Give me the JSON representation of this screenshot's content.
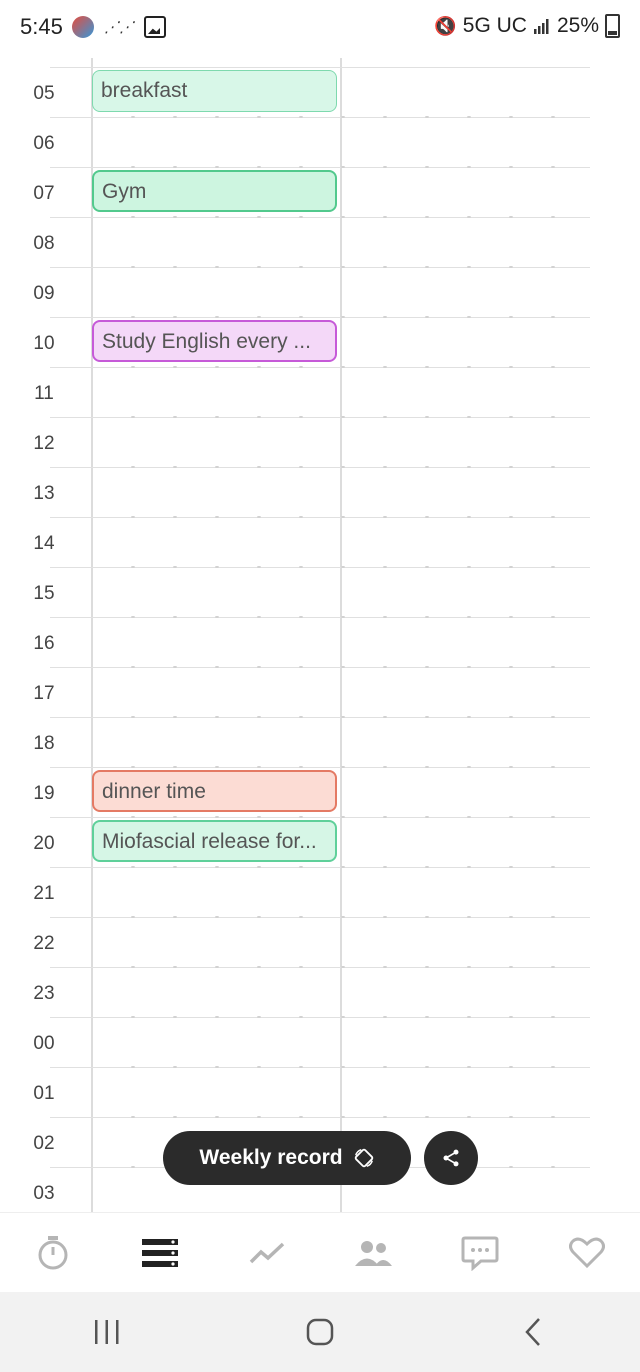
{
  "status_bar": {
    "time": "5:45",
    "network": "5G UC",
    "battery": "25%"
  },
  "hours": [
    "05",
    "06",
    "07",
    "08",
    "09",
    "10",
    "11",
    "12",
    "13",
    "14",
    "15",
    "16",
    "17",
    "18",
    "19",
    "20",
    "21",
    "22",
    "23",
    "00",
    "01",
    "02",
    "03"
  ],
  "events": [
    {
      "title": "breakfast",
      "hour": "05",
      "style": "mint"
    },
    {
      "title": "Gym",
      "hour": "07",
      "style": "green"
    },
    {
      "title": "Study English every ...",
      "hour": "10",
      "style": "purple"
    },
    {
      "title": "dinner time",
      "hour": "19",
      "style": "salmon"
    },
    {
      "title": "Miofascial release for...",
      "hour": "20",
      "style": "mint2"
    }
  ],
  "floating": {
    "weekly_label": "Weekly record"
  },
  "nav": [
    "timer-icon",
    "list-icon",
    "chart-icon",
    "people-icon",
    "chat-icon",
    "heart-icon"
  ],
  "colors": {
    "pill": "#2b2b2b",
    "active_nav": "#222222",
    "inactive_nav": "#b5b5b5"
  }
}
